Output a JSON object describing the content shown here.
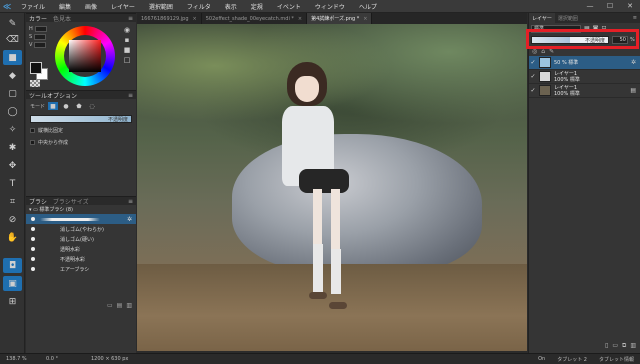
{
  "menubar": {
    "logo": "≪",
    "items": [
      "ファイル",
      "編集",
      "画像",
      "レイヤー",
      "選択範囲",
      "フィルタ",
      "表示",
      "定規",
      "イベント",
      "ウィンドウ",
      "ヘルプ"
    ],
    "window_controls": [
      "—",
      "☐",
      "✕"
    ]
  },
  "tabs": [
    {
      "label": "166761869129.jpg",
      "close": "×"
    },
    {
      "label": "502effect_shade_00eyecatch.mdi *",
      "close": "×"
    },
    {
      "label": "第4試練ポーズ.png *",
      "close": "×"
    }
  ],
  "left_panel": {
    "color": {
      "title": "カラー",
      "tab2": "色見本",
      "hsv_labels": [
        "H",
        "S",
        "V"
      ]
    },
    "tool_options": {
      "title": "ツールオプション",
      "mode_label": "モード",
      "opacity_label": "不透明度",
      "checkbox1": "縦横比固定",
      "checkbox2": "中央から作成"
    },
    "brush": {
      "title": "ブラシ",
      "tab2": "ブラシサイズ",
      "group_label": "標準ブラシ (8)",
      "items": [
        {
          "label": ""
        },
        {
          "label": "消しゴム(やわらか)"
        },
        {
          "label": "消しゴム(硬い)"
        },
        {
          "label": "透明水彩"
        },
        {
          "label": "不透明水彩"
        },
        {
          "label": "エアーブラシ"
        }
      ]
    }
  },
  "right_panel": {
    "tab1": "レイヤー",
    "tab2": "選択範囲",
    "blend_mode": "標準",
    "opacity_label": "不透明度",
    "opacity_value": "50",
    "opacity_fraction": 0.5,
    "opacity_unit": "%",
    "layers": [
      {
        "name": "",
        "detail": "50 % 標準",
        "selected": true
      },
      {
        "name": "レイヤー1",
        "detail": "100% 標準",
        "selected": false
      },
      {
        "name": "レイヤー1",
        "detail": "100% 標準",
        "selected": false
      }
    ]
  },
  "status": {
    "zoom": "138.7 %",
    "angle": "0.0 °",
    "size": "1200 × 630 px",
    "on": "On",
    "tablet1": "タブレット 2",
    "tablet2": "タブレット情報"
  },
  "colors": {
    "accent": "#1f6fb0",
    "highlight_frame": "#e41f26",
    "selected_row": "#2c5d85"
  }
}
